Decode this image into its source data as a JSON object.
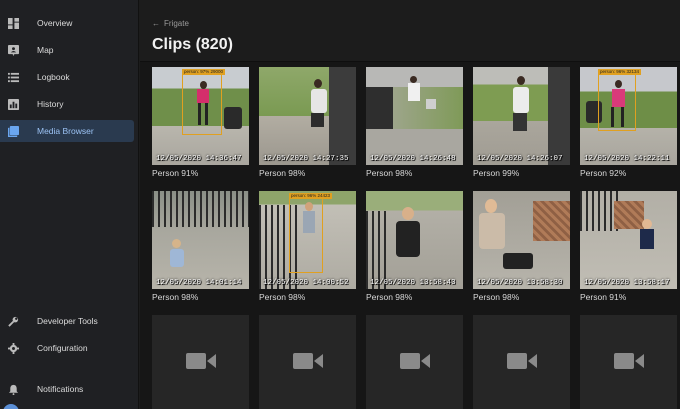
{
  "sidebar": {
    "items": [
      {
        "label": "Overview",
        "icon": "dashboard-icon",
        "active": false
      },
      {
        "label": "Map",
        "icon": "map-icon",
        "active": false
      },
      {
        "label": "Logbook",
        "icon": "logbook-icon",
        "active": false
      },
      {
        "label": "History",
        "icon": "history-icon",
        "active": false
      },
      {
        "label": "Media Browser",
        "icon": "media-browser-icon",
        "active": true
      },
      {
        "label": "Developer Tools",
        "icon": "wrench-icon",
        "active": false
      },
      {
        "label": "Configuration",
        "icon": "gear-icon",
        "active": false
      },
      {
        "label": "Notifications",
        "icon": "bell-icon",
        "active": false
      }
    ]
  },
  "header": {
    "back_label": "Frigate",
    "title": "Clips (820)"
  },
  "clips": [
    {
      "timestamp": "12/05/2020 14:36:47",
      "caption": "Person 91%",
      "box_label": "person: 97% 29000"
    },
    {
      "timestamp": "12/05/2020 14:27:35",
      "caption": "Person 98%"
    },
    {
      "timestamp": "12/05/2020 14:26:48",
      "caption": "Person 98%"
    },
    {
      "timestamp": "12/05/2020 14:26:07",
      "caption": "Person 99%"
    },
    {
      "timestamp": "12/05/2020 14:22:11",
      "caption": "Person 92%",
      "box_label": "person: 96% 32134"
    },
    {
      "timestamp": "12/05/2020 14:01:14",
      "caption": "Person 98%"
    },
    {
      "timestamp": "12/05/2020 14:00:52",
      "caption": "Person 98%",
      "box_label": "person: 96% 24423"
    },
    {
      "timestamp": "12/05/2020 13:58:43",
      "caption": "Person 98%"
    },
    {
      "timestamp": "12/05/2020 13:58:30",
      "caption": "Person 98%"
    },
    {
      "timestamp": "12/05/2020 13:58:17",
      "caption": "Person 91%"
    }
  ],
  "colors": {
    "accent": "#6aa6f0",
    "active_bg": "#2a3a4f",
    "placeholder_icon": "#8a8a8a"
  }
}
